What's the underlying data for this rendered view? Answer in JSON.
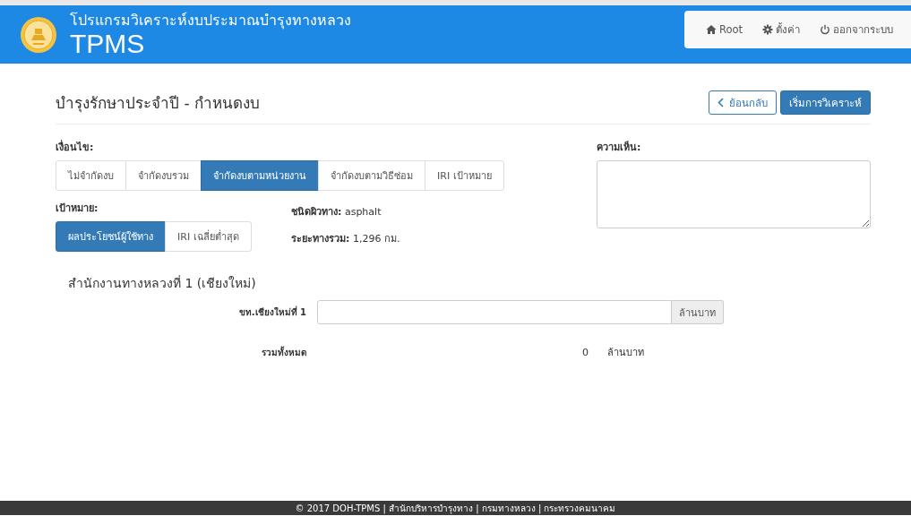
{
  "header": {
    "subtitle": "โปรแกรมวิเคราะห์งบประมาณบำรุงทางหลวง",
    "title": "TPMS",
    "nav": [
      {
        "kind": "home",
        "label": "Root"
      },
      {
        "kind": "gear",
        "label": "ตั้งค่า"
      },
      {
        "kind": "power",
        "label": "ออกจากระบบ"
      }
    ]
  },
  "page": {
    "title": "บำรุงรักษาประจำปี - กำหนดงบ",
    "back_button": "ย้อนกลับ",
    "start_button": "เริ่มการวิเคราะห์"
  },
  "condition": {
    "label": "เงื่อนไข:",
    "options": [
      {
        "label": "ไม่จำกัดงบ",
        "selected": false
      },
      {
        "label": "จำกัดงบรวม",
        "selected": false
      },
      {
        "label": "จำกัดงบตามหน่วยงาน",
        "selected": true
      },
      {
        "label": "จำกัดงบตามวิธีซ่อม",
        "selected": false
      },
      {
        "label": "IRI เป้าหมาย",
        "selected": false
      }
    ]
  },
  "target": {
    "label": "เป้าหมาย:",
    "options": [
      {
        "label": "ผลประโยชน์ผู้ใช้ทาง",
        "selected": true
      },
      {
        "label": "IRI เฉลี่ยต่ำสุด",
        "selected": false
      }
    ]
  },
  "info": [
    {
      "label": "ชนิดผิวทาง:",
      "value": "asphalt"
    },
    {
      "label": "ระยะทางรวม:",
      "value": "1,296 กม."
    }
  ],
  "comment": {
    "label": "ความเห็น:"
  },
  "region": {
    "title": "สำนักงานทางหลวงที่ 1 (เชียงใหม่)",
    "rows": [
      {
        "label": "ขท.เชียงใหม่ที่ 1",
        "unit": "ล้านบาท"
      }
    ],
    "total": {
      "label": "รวมทั้งหมด",
      "value": "0",
      "unit": "ล้านบาท"
    }
  },
  "footer": "© 2017 DOH-TPMS | สำนักบริหารบำรุงทาง | กรมทางหลวง | กระทรวงคมนาคม"
}
